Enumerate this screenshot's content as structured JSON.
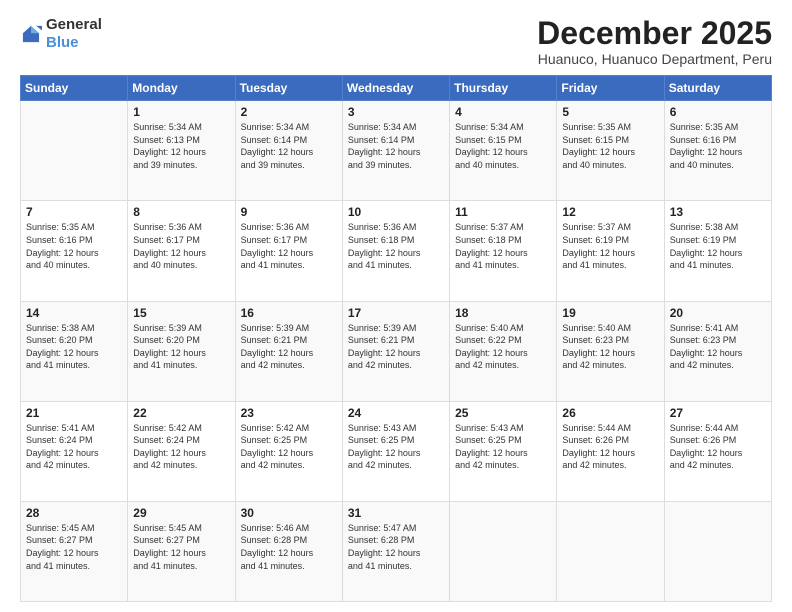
{
  "logo": {
    "general": "General",
    "blue": "Blue"
  },
  "title": "December 2025",
  "subtitle": "Huanuco, Huanuco Department, Peru",
  "days_header": [
    "Sunday",
    "Monday",
    "Tuesday",
    "Wednesday",
    "Thursday",
    "Friday",
    "Saturday"
  ],
  "weeks": [
    [
      {
        "day": "",
        "info": ""
      },
      {
        "day": "1",
        "info": "Sunrise: 5:34 AM\nSunset: 6:13 PM\nDaylight: 12 hours\nand 39 minutes."
      },
      {
        "day": "2",
        "info": "Sunrise: 5:34 AM\nSunset: 6:14 PM\nDaylight: 12 hours\nand 39 minutes."
      },
      {
        "day": "3",
        "info": "Sunrise: 5:34 AM\nSunset: 6:14 PM\nDaylight: 12 hours\nand 39 minutes."
      },
      {
        "day": "4",
        "info": "Sunrise: 5:34 AM\nSunset: 6:15 PM\nDaylight: 12 hours\nand 40 minutes."
      },
      {
        "day": "5",
        "info": "Sunrise: 5:35 AM\nSunset: 6:15 PM\nDaylight: 12 hours\nand 40 minutes."
      },
      {
        "day": "6",
        "info": "Sunrise: 5:35 AM\nSunset: 6:16 PM\nDaylight: 12 hours\nand 40 minutes."
      }
    ],
    [
      {
        "day": "7",
        "info": "Sunrise: 5:35 AM\nSunset: 6:16 PM\nDaylight: 12 hours\nand 40 minutes."
      },
      {
        "day": "8",
        "info": "Sunrise: 5:36 AM\nSunset: 6:17 PM\nDaylight: 12 hours\nand 40 minutes."
      },
      {
        "day": "9",
        "info": "Sunrise: 5:36 AM\nSunset: 6:17 PM\nDaylight: 12 hours\nand 41 minutes."
      },
      {
        "day": "10",
        "info": "Sunrise: 5:36 AM\nSunset: 6:18 PM\nDaylight: 12 hours\nand 41 minutes."
      },
      {
        "day": "11",
        "info": "Sunrise: 5:37 AM\nSunset: 6:18 PM\nDaylight: 12 hours\nand 41 minutes."
      },
      {
        "day": "12",
        "info": "Sunrise: 5:37 AM\nSunset: 6:19 PM\nDaylight: 12 hours\nand 41 minutes."
      },
      {
        "day": "13",
        "info": "Sunrise: 5:38 AM\nSunset: 6:19 PM\nDaylight: 12 hours\nand 41 minutes."
      }
    ],
    [
      {
        "day": "14",
        "info": "Sunrise: 5:38 AM\nSunset: 6:20 PM\nDaylight: 12 hours\nand 41 minutes."
      },
      {
        "day": "15",
        "info": "Sunrise: 5:39 AM\nSunset: 6:20 PM\nDaylight: 12 hours\nand 41 minutes."
      },
      {
        "day": "16",
        "info": "Sunrise: 5:39 AM\nSunset: 6:21 PM\nDaylight: 12 hours\nand 42 minutes."
      },
      {
        "day": "17",
        "info": "Sunrise: 5:39 AM\nSunset: 6:21 PM\nDaylight: 12 hours\nand 42 minutes."
      },
      {
        "day": "18",
        "info": "Sunrise: 5:40 AM\nSunset: 6:22 PM\nDaylight: 12 hours\nand 42 minutes."
      },
      {
        "day": "19",
        "info": "Sunrise: 5:40 AM\nSunset: 6:23 PM\nDaylight: 12 hours\nand 42 minutes."
      },
      {
        "day": "20",
        "info": "Sunrise: 5:41 AM\nSunset: 6:23 PM\nDaylight: 12 hours\nand 42 minutes."
      }
    ],
    [
      {
        "day": "21",
        "info": "Sunrise: 5:41 AM\nSunset: 6:24 PM\nDaylight: 12 hours\nand 42 minutes."
      },
      {
        "day": "22",
        "info": "Sunrise: 5:42 AM\nSunset: 6:24 PM\nDaylight: 12 hours\nand 42 minutes."
      },
      {
        "day": "23",
        "info": "Sunrise: 5:42 AM\nSunset: 6:25 PM\nDaylight: 12 hours\nand 42 minutes."
      },
      {
        "day": "24",
        "info": "Sunrise: 5:43 AM\nSunset: 6:25 PM\nDaylight: 12 hours\nand 42 minutes."
      },
      {
        "day": "25",
        "info": "Sunrise: 5:43 AM\nSunset: 6:25 PM\nDaylight: 12 hours\nand 42 minutes."
      },
      {
        "day": "26",
        "info": "Sunrise: 5:44 AM\nSunset: 6:26 PM\nDaylight: 12 hours\nand 42 minutes."
      },
      {
        "day": "27",
        "info": "Sunrise: 5:44 AM\nSunset: 6:26 PM\nDaylight: 12 hours\nand 42 minutes."
      }
    ],
    [
      {
        "day": "28",
        "info": "Sunrise: 5:45 AM\nSunset: 6:27 PM\nDaylight: 12 hours\nand 41 minutes."
      },
      {
        "day": "29",
        "info": "Sunrise: 5:45 AM\nSunset: 6:27 PM\nDaylight: 12 hours\nand 41 minutes."
      },
      {
        "day": "30",
        "info": "Sunrise: 5:46 AM\nSunset: 6:28 PM\nDaylight: 12 hours\nand 41 minutes."
      },
      {
        "day": "31",
        "info": "Sunrise: 5:47 AM\nSunset: 6:28 PM\nDaylight: 12 hours\nand 41 minutes."
      },
      {
        "day": "",
        "info": ""
      },
      {
        "day": "",
        "info": ""
      },
      {
        "day": "",
        "info": ""
      }
    ]
  ]
}
